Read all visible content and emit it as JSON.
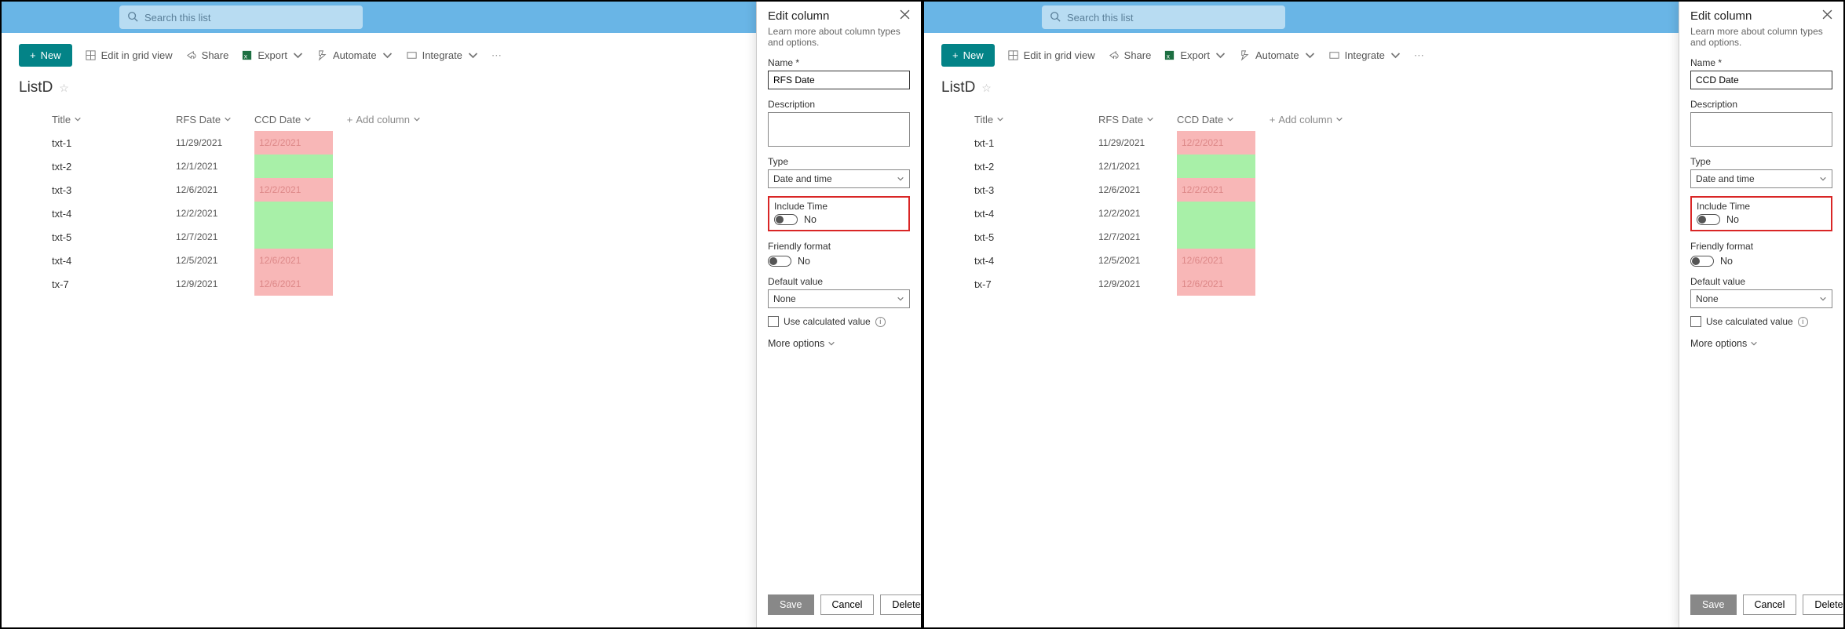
{
  "search": {
    "placeholder": "Search this list"
  },
  "commands": {
    "new": "New",
    "editgrid": "Edit in grid view",
    "share": "Share",
    "export": "Export",
    "automate": "Automate",
    "integrate": "Integrate"
  },
  "list": {
    "title": "ListD"
  },
  "columns": {
    "title": "Title",
    "rfs": "RFS Date",
    "ccd": "CCD Date",
    "add": "Add column"
  },
  "rows": [
    {
      "title": "txt-1",
      "rfs": "11/29/2021",
      "ccd": "12/2/2021",
      "bg": "r"
    },
    {
      "title": "txt-2",
      "rfs": "12/1/2021",
      "ccd": "",
      "bg": "g"
    },
    {
      "title": "txt-3",
      "rfs": "12/6/2021",
      "ccd": "12/2/2021",
      "bg": "r"
    },
    {
      "title": "txt-4",
      "rfs": "12/2/2021",
      "ccd": "",
      "bg": "g"
    },
    {
      "title": "txt-5",
      "rfs": "12/7/2021",
      "ccd": "",
      "bg": "g"
    },
    {
      "title": "txt-4",
      "rfs": "12/5/2021",
      "ccd": "12/6/2021",
      "bg": "r"
    },
    {
      "title": "tx-7",
      "rfs": "12/9/2021",
      "ccd": "12/6/2021",
      "bg": "r"
    }
  ],
  "editpanel": {
    "title": "Edit column",
    "subtitle": "Learn more about column types and options.",
    "name_label": "Name *",
    "desc_label": "Description",
    "type_label": "Type",
    "type_value": "Date and time",
    "include_label": "Include Time",
    "toggle_value": "No",
    "friendly_label": "Friendly format",
    "default_label": "Default value",
    "default_value": "None",
    "calc_label": "Use calculated value",
    "more_options": "More options",
    "save": "Save",
    "cancel": "Cancel",
    "delete": "Delete"
  },
  "panels": [
    {
      "name_value": "RFS Date"
    },
    {
      "name_value": "CCD Date"
    }
  ]
}
